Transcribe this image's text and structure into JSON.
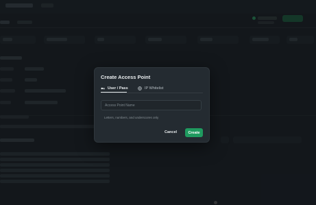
{
  "modal": {
    "title": "Create Access Point",
    "tabs": [
      {
        "label": "User / Pass",
        "icon": "key-icon",
        "active": true
      },
      {
        "label": "IP Whitelist",
        "icon": "globe-icon",
        "active": false
      }
    ],
    "name_input": {
      "placeholder": "Access Point Name",
      "value": ""
    },
    "hint": "Letters, numbers, and underscores only",
    "cancel_label": "Cancel",
    "create_label": "Create"
  },
  "colors": {
    "accent": "#1f9a5f",
    "modal_bg": "#242b31",
    "page_bg": "#1a2025"
  }
}
